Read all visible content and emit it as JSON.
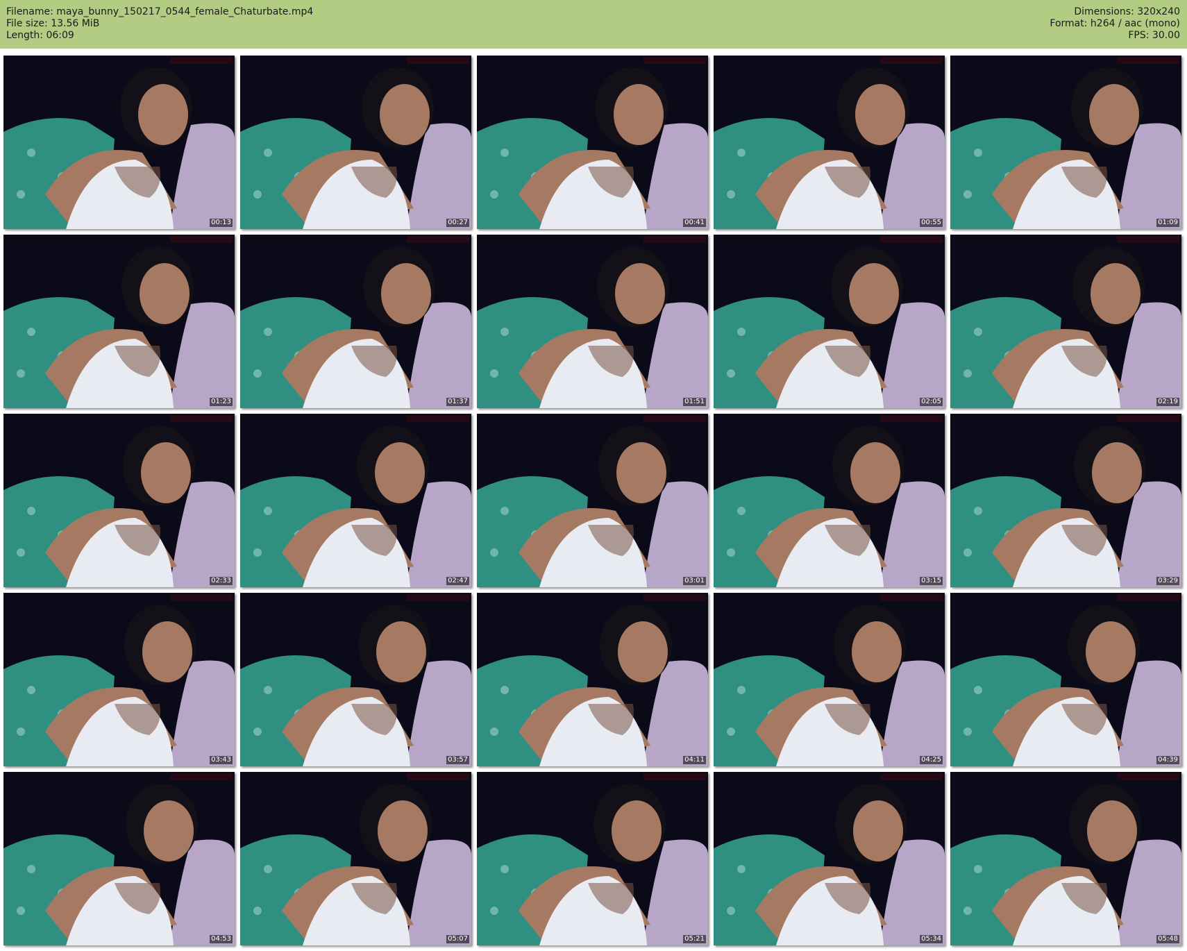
{
  "header": {
    "filename": "Filename: maya_bunny_150217_0544_female_Chaturbate.mp4",
    "filesize": "File size: 13.56 MiB",
    "length": "Length: 06:09",
    "dimensions": "Dimensions: 320x240",
    "format": "Format: h264 / aac (mono)",
    "fps": "FPS: 30.00"
  },
  "thumbnails": [
    {
      "time": "00:13"
    },
    {
      "time": "00:27"
    },
    {
      "time": "00:41"
    },
    {
      "time": "00:55"
    },
    {
      "time": "01:09"
    },
    {
      "time": "01:23"
    },
    {
      "time": "01:37"
    },
    {
      "time": "01:51"
    },
    {
      "time": "02:05"
    },
    {
      "time": "02:19"
    },
    {
      "time": "02:33"
    },
    {
      "time": "02:47"
    },
    {
      "time": "03:01"
    },
    {
      "time": "03:15"
    },
    {
      "time": "03:29"
    },
    {
      "time": "03:43"
    },
    {
      "time": "03:57"
    },
    {
      "time": "04:11"
    },
    {
      "time": "04:25"
    },
    {
      "time": "04:39"
    },
    {
      "time": "04:53"
    },
    {
      "time": "05:07"
    },
    {
      "time": "05:21"
    },
    {
      "time": "05:34"
    },
    {
      "time": "05:48"
    }
  ],
  "colors": {
    "header_bg": "#b3cc83",
    "frame_bg": "#0a0a18",
    "blanket": "#2f8f80",
    "top": "#e8ecf2",
    "pillow": "#b8a6c8",
    "skin": "#a67a62",
    "hair": "#141018"
  }
}
